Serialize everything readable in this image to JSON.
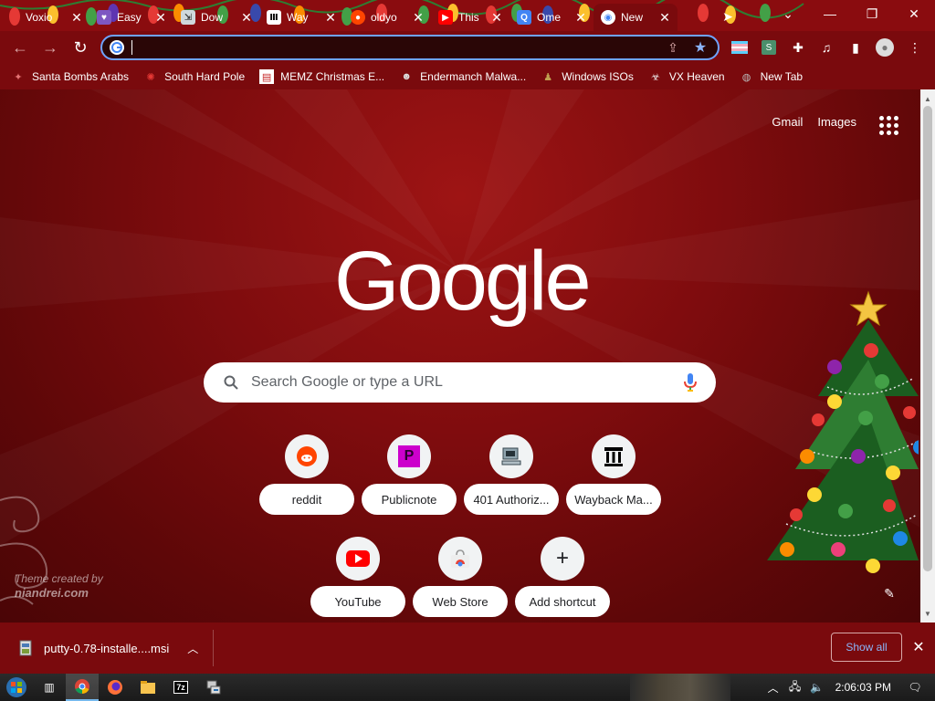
{
  "tabs": [
    {
      "label": "Voxio",
      "icon": "light-bulb-icon"
    },
    {
      "label": "Easy",
      "icon": "easy-icon"
    },
    {
      "label": "Dow",
      "icon": "download-icon"
    },
    {
      "label": "Way",
      "icon": "wayback-icon"
    },
    {
      "label": "oldyo",
      "icon": "reddit-icon"
    },
    {
      "label": "This",
      "icon": "youtube-icon"
    },
    {
      "label": "Ome",
      "icon": "ome-icon"
    },
    {
      "label": "New",
      "icon": "chrome-icon",
      "active": true
    }
  ],
  "window_controls": {
    "dropdown": "⌄",
    "minimize": "—",
    "restore": "❐",
    "close": "✕"
  },
  "omnibox": {
    "value": "",
    "placeholder": ""
  },
  "bookmarks": [
    {
      "label": "Santa Bombs Arabs",
      "icon": "santa-icon"
    },
    {
      "label": "South Hard Pole",
      "icon": "snowflake-icon"
    },
    {
      "label": "MEMZ Christmas E...",
      "icon": "memz-icon"
    },
    {
      "label": "Endermanch Malwa...",
      "icon": "enderman-icon"
    },
    {
      "label": "Windows ISOs",
      "icon": "windows-iso-icon"
    },
    {
      "label": "VX Heaven",
      "icon": "vx-heaven-icon"
    },
    {
      "label": "New Tab",
      "icon": "globe-icon"
    }
  ],
  "ntp": {
    "gmail": "Gmail",
    "images": "Images",
    "logo": "Google",
    "search_placeholder": "Search Google or type a URL",
    "shortcuts": [
      {
        "label": "reddit",
        "icon": "reddit-icon"
      },
      {
        "label": "Publicnote",
        "icon": "publicnote-icon"
      },
      {
        "label": "401 Authoriz...",
        "icon": "computer-icon"
      },
      {
        "label": "Wayback Ma...",
        "icon": "wayback-icon"
      },
      {
        "label": "YouTube",
        "icon": "youtube-icon"
      },
      {
        "label": "Web Store",
        "icon": "web-store-icon"
      },
      {
        "label": "Add shortcut",
        "icon": "plus-icon"
      }
    ],
    "credit_line1": "Theme created by",
    "credit_line2": "niandrei.com"
  },
  "download": {
    "file": "putty-0.78-installe....msi",
    "show_all": "Show all"
  },
  "taskbar": {
    "clock": "2:06:03 PM"
  },
  "colors": {
    "frame": "#7a0a0d",
    "accent": "#8ab4f8",
    "ntp_bg": "#7f0c0e"
  }
}
